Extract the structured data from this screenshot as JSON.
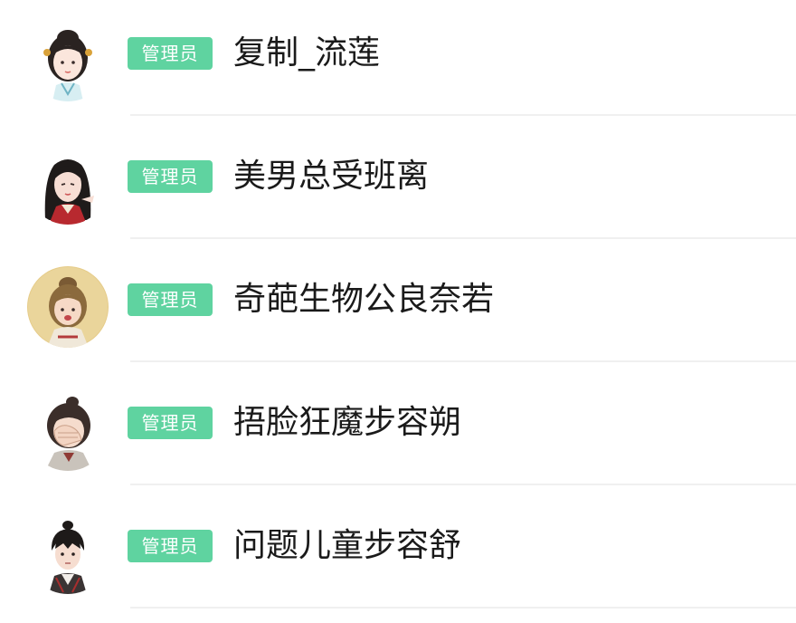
{
  "members": [
    {
      "role": "管理员",
      "name": "复制_流莲",
      "avatar_icon": "avatar-icon"
    },
    {
      "role": "管理员",
      "name": "美男总受班离",
      "avatar_icon": "avatar-icon"
    },
    {
      "role": "管理员",
      "name": "奇葩生物公良奈若",
      "avatar_icon": "avatar-icon"
    },
    {
      "role": "管理员",
      "name": "捂脸狂魔步容朔",
      "avatar_icon": "avatar-icon"
    },
    {
      "role": "管理员",
      "name": "问题儿童步容舒",
      "avatar_icon": "avatar-icon"
    }
  ],
  "colors": {
    "badge": "#5fd3a0",
    "name_text": "#1a1a1a",
    "divider": "#f0f0f0",
    "background": "#ffffff"
  }
}
